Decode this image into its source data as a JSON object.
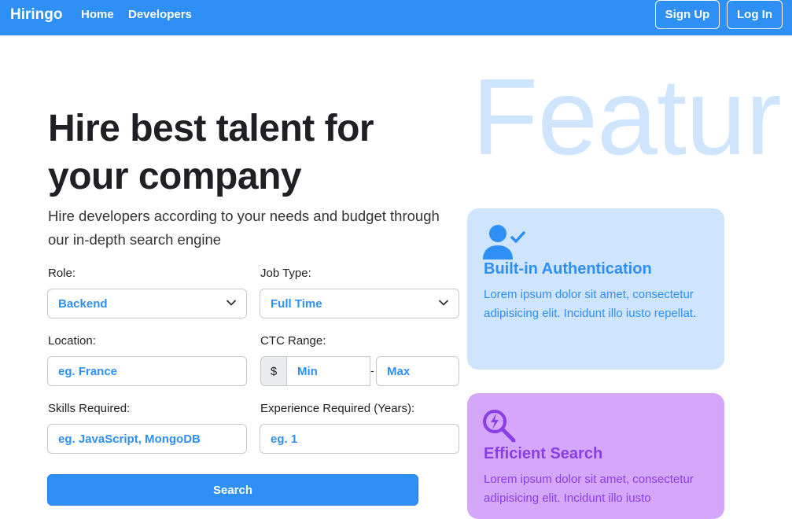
{
  "nav": {
    "brand": "Hiringo",
    "links": [
      "Home",
      "Developers"
    ],
    "signup": "Sign Up",
    "login": "Log In"
  },
  "hero": {
    "background_word": "Featur",
    "title": "Hire best talent for your company",
    "subtitle": "Hire developers according to your needs and budget through our in-depth search engine"
  },
  "form": {
    "role": {
      "label": "Role:",
      "value": "Backend"
    },
    "job_type": {
      "label": "Job Type:",
      "value": "Full Time"
    },
    "location": {
      "label": "Location:",
      "placeholder": "eg. France"
    },
    "ctc": {
      "label": "CTC Range:",
      "currency": "$",
      "min_placeholder": "Min",
      "separator": "-",
      "max_placeholder": "Max"
    },
    "skills": {
      "label": "Skills Required:",
      "placeholder": "eg. JavaScript, MongoDB"
    },
    "experience": {
      "label": "Experience Required (Years):",
      "placeholder": "eg. 1"
    },
    "search_label": "Search"
  },
  "features": [
    {
      "icon": "user-check-icon",
      "title": "Built-in Authentication",
      "text": "Lorem ipsum dolor sit amet, consectetur adipisicing elit. Incidunt illo iusto repellat."
    },
    {
      "icon": "search-bolt-icon",
      "title": "Efficient Search",
      "text": "Lorem ipsum dolor sit amet, consectetur adipisicing elit. Incidunt illo iusto"
    }
  ],
  "colors": {
    "primary": "#2e8ff5",
    "card_blue": "#cfe5fd",
    "card_purple": "#d4a7fb",
    "accent_purple": "#8a3ee6"
  }
}
